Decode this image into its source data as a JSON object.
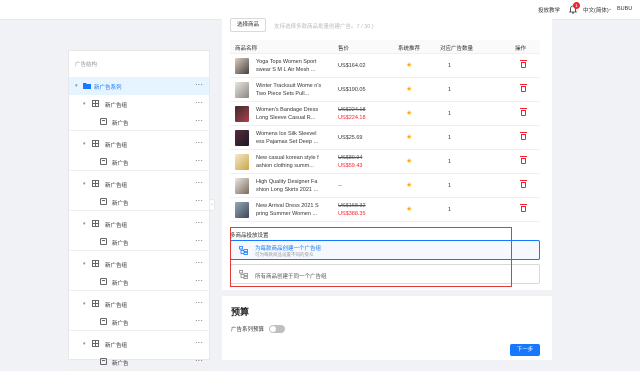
{
  "topbar": {
    "tutorial": "投放教学",
    "notif_count": "1",
    "language": "中文(简体)",
    "user": "BUBU"
  },
  "sidebar": {
    "title": "广告结构",
    "root_label": "新广告系列",
    "groups": [
      {
        "group_label": "新广告组",
        "ad_label": "新广告"
      },
      {
        "group_label": "新广告组",
        "ad_label": "新广告"
      },
      {
        "group_label": "新广告组",
        "ad_label": "新广告"
      },
      {
        "group_label": "新广告组",
        "ad_label": "新广告"
      },
      {
        "group_label": "新广告组",
        "ad_label": "新广告"
      },
      {
        "group_label": "新广告组",
        "ad_label": "新广告"
      },
      {
        "group_label": "新广告组",
        "ad_label": "新广告"
      }
    ]
  },
  "products": {
    "select_button": "选择商品",
    "hint": "支持选择多款商品批量创建广告。7 / 30 )",
    "headers": {
      "name": "商品名称",
      "price": "售价",
      "recommend": "系统推荐",
      "ad_count": "对应广告数量",
      "action": "操作"
    },
    "rows": [
      {
        "name": "Yoga Tops Women Sport swear S M L Air Mesh ...",
        "price": "US$164.02",
        "orig_price": "",
        "count": "1"
      },
      {
        "name": "Winter Tracksuit Wome n's Two Piece Sets Pull...",
        "price": "US$190.05",
        "orig_price": "",
        "count": "1"
      },
      {
        "name": "Women's Bandage Dress Long Sleeve Casual R...",
        "price": "US$224.18",
        "orig_price": "US$224.18",
        "count": "1"
      },
      {
        "name": "Womens Ice Silk Sleevel ess Pajamas Set Deep ...",
        "price": "US$25.69",
        "orig_price": "",
        "count": "1"
      },
      {
        "name": "New casual korean style f ashion clothing summ...",
        "price": "US$59.43",
        "orig_price": "US$80.94",
        "count": "1"
      },
      {
        "name": "High Quality Designer Fa shion Long Skirts 2021 ...",
        "price": "--",
        "orig_price": "",
        "count": "1"
      },
      {
        "name": "New Arrival Dress 2021 S pring Summer Women ...",
        "price": "US$388.35",
        "orig_price": "US$168.32",
        "count": "1"
      }
    ]
  },
  "placement": {
    "title": "多商品投放设置",
    "option1_title": "为每款商品创建一个广告组",
    "option1_sub": "可为每款商品设置不同的受众",
    "option2_title": "所有商品创建于同一个广告组"
  },
  "budget": {
    "title": "预算",
    "campaign_budget_label": "广告系列预算"
  },
  "footer": {
    "next_button": "下一步"
  }
}
